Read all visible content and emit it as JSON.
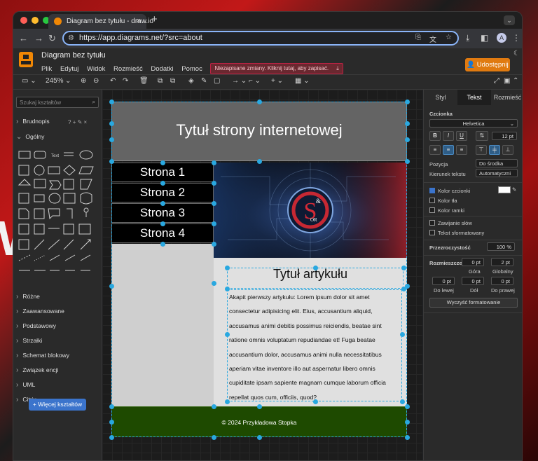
{
  "browser": {
    "tab_title": "Diagram bez tytułu - draw.io",
    "new_tab": "+",
    "url": "https://app.diagrams.net/?src=about",
    "avatar": "A"
  },
  "app": {
    "title": "Diagram bez tytułu",
    "menus": [
      "Plik",
      "Edytuj",
      "Widok",
      "Rozmieść",
      "Dodatki",
      "Pomoc"
    ],
    "unsaved": "Niezapisane zmiany. Kliknij tutaj, aby zapisać.",
    "share": "Udostępnij",
    "zoom": "245%"
  },
  "left_panel": {
    "search_placeholder": "Szukaj kształtów",
    "scratchpad": "Brudnopis",
    "general": "Ogólny",
    "sections": [
      "Różne",
      "Zaawansowane",
      "Podstawowy",
      "Strzałki",
      "Schemat blokowy",
      "Związek encji",
      "UML",
      "Citrix"
    ],
    "more_shapes": "+ Więcej kształtów"
  },
  "diagram": {
    "page_title": "Tytuł strony internetowej",
    "nav": [
      "Strona 1",
      "Strona 2",
      "Strona 3",
      "Strona 4"
    ],
    "article_title": "Tytuł artykułu",
    "article_lines": [
      "Akapit pierwszy artykułu: Lorem ipsum dolor sit amet",
      "consectetur adipisicing elit. Eius, accusantium aliquid,",
      "accusamus animi debitis possimus reiciendis, beatae sint",
      "ratione omnis voluptatum repudiandae et! Fuga beatae",
      "accusantium dolor, accusamus animi nulla necessitatibus",
      "aperiam vitae inventore illo aut aspernatur libero omnis",
      "cupiditate ipsam sapiente magnam cumque laborum officia",
      "repellat quos cum, officiis, quod?"
    ],
    "footer": "© 2024 Przykładowa Stopka",
    "colors": {
      "header": "#646464",
      "nav": "#000000",
      "sidebar": "#cfcfcf",
      "article": "#e0e0e0",
      "footer": "#1e4a00",
      "handle": "#29a8e0"
    }
  },
  "format_panel": {
    "tabs": [
      "Styl",
      "Tekst",
      "Rozmieść"
    ],
    "font_section": "Czcionka",
    "font": "Helvetica",
    "font_size": "12 pt",
    "position_label": "Pozycja",
    "position_value": "Do środka",
    "direction_label": "Kierunek tekstu",
    "direction_value": "Automatyczni",
    "font_color": "Kolor czcionki",
    "background_color": "Kolor tła",
    "border_color": "Kolor ramki",
    "wrap": "Zawijanie słów",
    "formatted": "Tekst sformatowany",
    "opacity_label": "Przezroczystość",
    "opacity_value": "100 %",
    "spacing_label": "Rozmieszcze",
    "spacing_top": "0 pt",
    "spacing_global": "2 pt",
    "top_label": "Góra",
    "global_label": "Globalny",
    "spacing_left": "0 pt",
    "spacing_bottom": "0 pt",
    "spacing_right": "0 pt",
    "left_label": "Do lewej",
    "bottom_label": "Dół",
    "right_label": "Do prawej",
    "clear": "Wyczyść formatowanie"
  }
}
